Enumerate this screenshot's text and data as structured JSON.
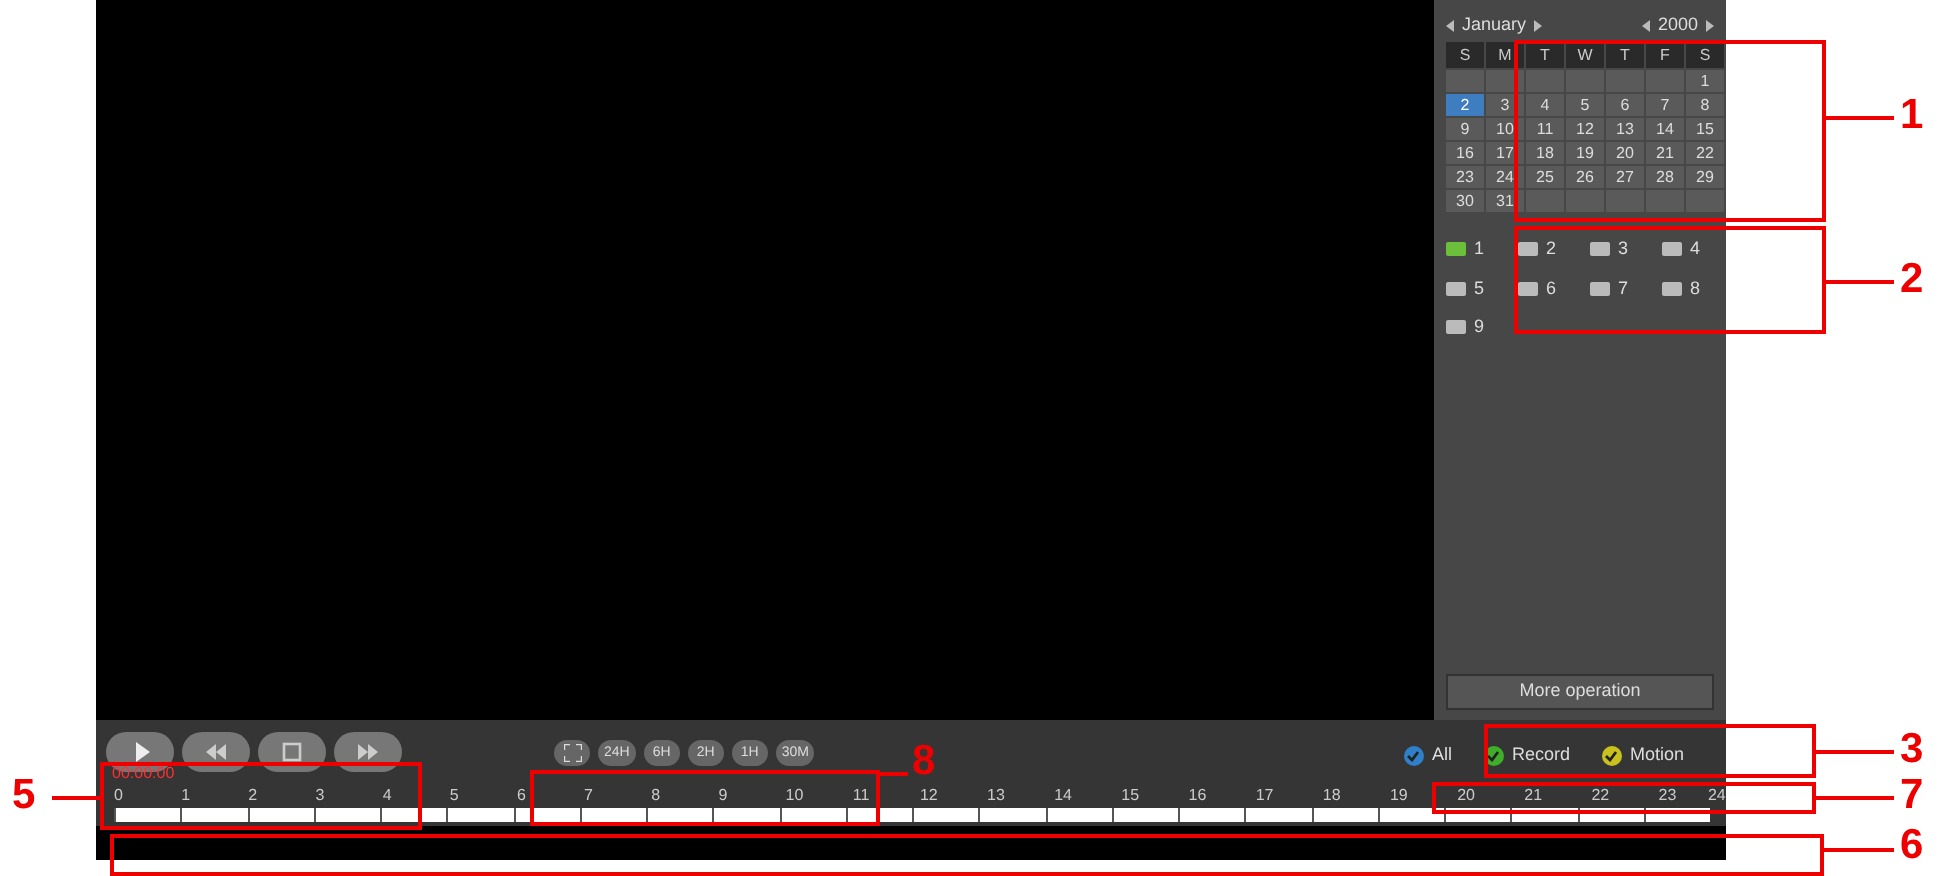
{
  "calendar": {
    "month": "January",
    "year": "2000",
    "weekdays": [
      "S",
      "M",
      "T",
      "W",
      "T",
      "F",
      "S"
    ],
    "weeks": [
      [
        {
          "kind": "blank"
        },
        {
          "kind": "blank"
        },
        {
          "kind": "blank"
        },
        {
          "kind": "blank"
        },
        {
          "kind": "blank"
        },
        {
          "kind": "blank"
        },
        {
          "kind": "day",
          "label": "1",
          "selected": false
        }
      ],
      [
        {
          "kind": "day",
          "label": "2",
          "selected": true
        },
        {
          "kind": "day",
          "label": "3",
          "selected": false
        },
        {
          "kind": "day",
          "label": "4",
          "selected": false
        },
        {
          "kind": "day",
          "label": "5",
          "selected": false
        },
        {
          "kind": "day",
          "label": "6",
          "selected": false
        },
        {
          "kind": "day",
          "label": "7",
          "selected": false
        },
        {
          "kind": "day",
          "label": "8",
          "selected": false
        }
      ],
      [
        {
          "kind": "day",
          "label": "9",
          "selected": false
        },
        {
          "kind": "day",
          "label": "10",
          "selected": false
        },
        {
          "kind": "day",
          "label": "11",
          "selected": false
        },
        {
          "kind": "day",
          "label": "12",
          "selected": false
        },
        {
          "kind": "day",
          "label": "13",
          "selected": false
        },
        {
          "kind": "day",
          "label": "14",
          "selected": false
        },
        {
          "kind": "day",
          "label": "15",
          "selected": false
        }
      ],
      [
        {
          "kind": "day",
          "label": "16",
          "selected": false
        },
        {
          "kind": "day",
          "label": "17",
          "selected": false
        },
        {
          "kind": "day",
          "label": "18",
          "selected": false
        },
        {
          "kind": "day",
          "label": "19",
          "selected": false
        },
        {
          "kind": "day",
          "label": "20",
          "selected": false
        },
        {
          "kind": "day",
          "label": "21",
          "selected": false
        },
        {
          "kind": "day",
          "label": "22",
          "selected": false
        }
      ],
      [
        {
          "kind": "day",
          "label": "23",
          "selected": false
        },
        {
          "kind": "day",
          "label": "24",
          "selected": false
        },
        {
          "kind": "day",
          "label": "25",
          "selected": false
        },
        {
          "kind": "day",
          "label": "26",
          "selected": false
        },
        {
          "kind": "day",
          "label": "27",
          "selected": false
        },
        {
          "kind": "day",
          "label": "28",
          "selected": false
        },
        {
          "kind": "day",
          "label": "29",
          "selected": false
        }
      ],
      [
        {
          "kind": "day",
          "label": "30",
          "selected": false
        },
        {
          "kind": "day",
          "label": "31",
          "selected": false
        },
        {
          "kind": "blank"
        },
        {
          "kind": "blank"
        },
        {
          "kind": "blank"
        },
        {
          "kind": "blank"
        },
        {
          "kind": "blank"
        }
      ]
    ]
  },
  "channels": [
    {
      "label": "1",
      "checked": true
    },
    {
      "label": "2",
      "checked": false
    },
    {
      "label": "3",
      "checked": false
    },
    {
      "label": "4",
      "checked": false
    },
    {
      "label": "5",
      "checked": false
    },
    {
      "label": "6",
      "checked": false
    },
    {
      "label": "7",
      "checked": false
    },
    {
      "label": "8",
      "checked": false
    },
    {
      "label": "9",
      "checked": false
    }
  ],
  "more_button": "More operation",
  "playback_buttons": [
    {
      "kind": "play"
    },
    {
      "kind": "rewind"
    },
    {
      "kind": "stop"
    },
    {
      "kind": "forward"
    }
  ],
  "zoom_buttons": [
    {
      "kind": "fit"
    },
    {
      "kind": "text",
      "label": "24H"
    },
    {
      "kind": "text",
      "label": "6H"
    },
    {
      "kind": "text",
      "label": "2H"
    },
    {
      "kind": "text",
      "label": "1H"
    },
    {
      "kind": "text",
      "label": "30M"
    }
  ],
  "filters": [
    {
      "label": "All",
      "checked": true,
      "color": "#2f80c8"
    },
    {
      "label": "Record",
      "checked": true,
      "color": "#3fae2a"
    },
    {
      "label": "Motion",
      "checked": true,
      "color": "#c9c21e"
    }
  ],
  "time": "00:00:00",
  "hours": [
    "0",
    "1",
    "2",
    "3",
    "4",
    "5",
    "6",
    "7",
    "8",
    "9",
    "10",
    "11",
    "12",
    "13",
    "14",
    "15",
    "16",
    "17",
    "18",
    "19",
    "20",
    "21",
    "22",
    "23",
    "24"
  ],
  "callouts": [
    {
      "label": "1"
    },
    {
      "label": "2"
    },
    {
      "label": "3"
    },
    {
      "label": "7"
    },
    {
      "label": "6"
    },
    {
      "label": "5"
    },
    {
      "label": "8"
    }
  ]
}
